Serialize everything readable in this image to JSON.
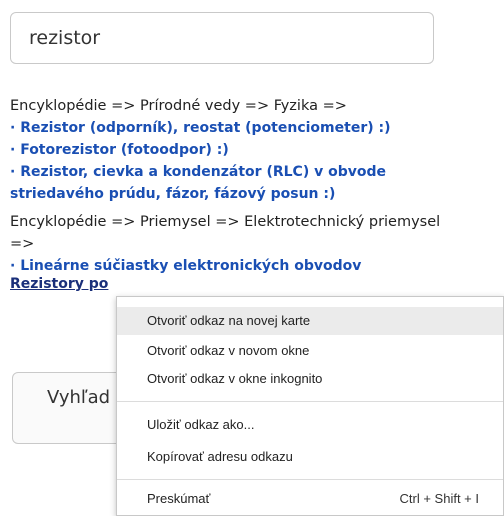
{
  "search": {
    "value": "rezistor"
  },
  "results": [
    {
      "crumb": "Encyklopédie => Prírodné vedy => Fyzika =>",
      "links": [
        "· Rezistor (odporník), reostat (potenciometer) :)",
        "· Fotorezistor (fotoodpor) :)",
        "· Rezistor, cievka a kondenzátor (RLC) v obvode striedavého prúdu, fázor, fázový posun :)"
      ]
    },
    {
      "crumb": "Encyklopédie => Priemysel => Elektrotechnický priemysel =>",
      "links": [
        "· Lineárne súčiastky elektronických obvodov",
        "Rezistory po"
      ]
    }
  ],
  "search_button": {
    "label": "Vyhľad"
  },
  "context_menu": {
    "items": [
      {
        "label": "Otvoriť odkaz na novej karte",
        "shortcut": ""
      },
      {
        "label": "Otvoriť odkaz v novom okne",
        "shortcut": ""
      },
      {
        "label": "Otvoriť odkaz v okne inkognito",
        "shortcut": ""
      },
      {
        "label": "Uložiť odkaz ako...",
        "shortcut": ""
      },
      {
        "label": "Kopírovať adresu odkazu",
        "shortcut": ""
      },
      {
        "label": "Preskúmať",
        "shortcut": "Ctrl + Shift + I"
      }
    ]
  }
}
